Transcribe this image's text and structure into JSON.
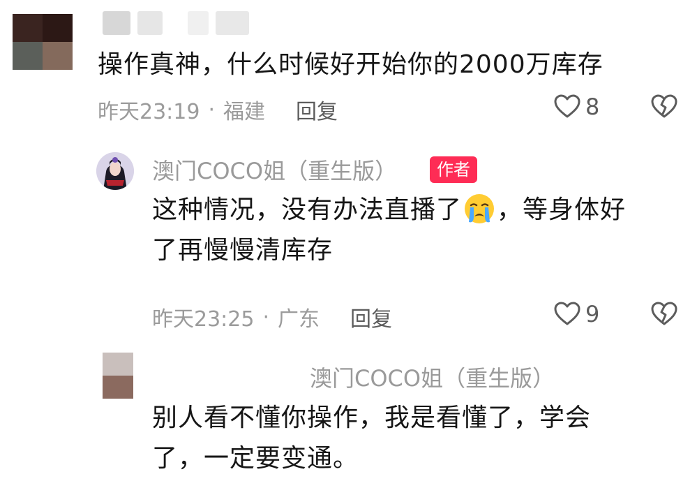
{
  "comments": [
    {
      "text": "操作真神，什么时候好开始你的2000万库存",
      "time": "昨天23:19",
      "location": "福建",
      "reply_label": "回复",
      "likes": "8"
    },
    {
      "author": "澳门COCO姐（重生版）",
      "author_badge": "作者",
      "text_line1": "这种情况，没有办法直播了",
      "emoji": "loudly-crying-face",
      "text_line1_suffix": "，等身体好",
      "text_line2": "了再慢慢清库存",
      "time": "昨天23:25",
      "location": "广东",
      "reply_label": "回复",
      "likes": "9"
    },
    {
      "mention": "澳门COCO姐（重生版）",
      "text_line1": "别人看不懂你操作，我是看懂了，学会",
      "text_line2": "了，一定要变通。"
    }
  ],
  "separator": "·",
  "colors": {
    "badge": "#fe2c55",
    "meta_text": "#9b9b9b",
    "body_text": "#161616"
  }
}
